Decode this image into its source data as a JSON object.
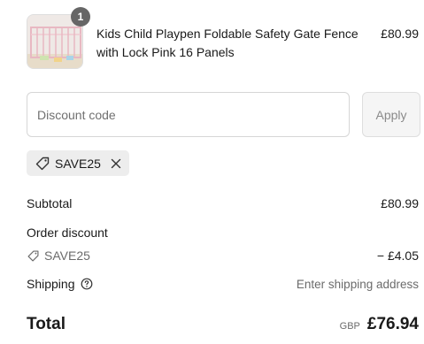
{
  "product": {
    "title": "Kids Child Playpen Foldable Safety Gate Fence with Lock Pink 16 Panels",
    "price": "£80.99",
    "quantity": "1",
    "image_icon": "playpen-product-image"
  },
  "discount": {
    "placeholder": "Discount code",
    "apply_label": "Apply",
    "applied_code": "SAVE25"
  },
  "summary": {
    "subtotal_label": "Subtotal",
    "subtotal_value": "£80.99",
    "order_discount_label": "Order discount",
    "discount_code": "SAVE25",
    "discount_value": "− £4.05",
    "shipping_label": "Shipping",
    "shipping_value": "Enter shipping address",
    "total_label": "Total",
    "currency": "GBP",
    "total_value": "£76.94"
  },
  "colors": {
    "badge": "#666666",
    "chip_background": "#ededed",
    "muted_text": "#6b6b6b",
    "apply_disabled_bg": "#f5f5f5"
  }
}
